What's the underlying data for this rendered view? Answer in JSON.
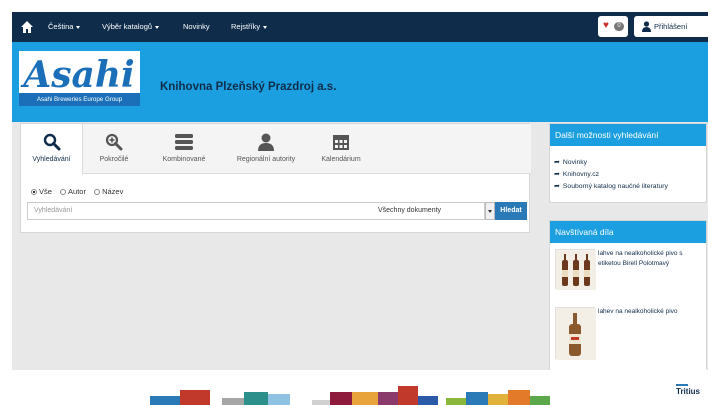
{
  "navbar": {
    "items": [
      {
        "label": "Čeština",
        "dropdown": true
      },
      {
        "label": "Výběr katalogů",
        "dropdown": true
      },
      {
        "label": "Novinky",
        "dropdown": false
      },
      {
        "label": "Rejstříky",
        "dropdown": true
      }
    ],
    "favorites_count": "0",
    "login_label": "Přihlášení"
  },
  "header": {
    "logo_wordmark": "Asahi",
    "logo_subtitle": "Asahi Breweries Europe Group",
    "library_name": "Knihovna Plzeňský Prazdroj a.s."
  },
  "search": {
    "tabs": [
      {
        "label": "Vyhledávání",
        "icon": "search-icon"
      },
      {
        "label": "Pokročilé",
        "icon": "zoom-in-icon"
      },
      {
        "label": "Kombinované",
        "icon": "stack-icon"
      },
      {
        "label": "Regionální autority",
        "icon": "user-icon"
      },
      {
        "label": "Kalendárium",
        "icon": "calendar-icon"
      }
    ],
    "scope_options": [
      "Vše",
      "Autor",
      "Název"
    ],
    "selected_scope": "Vše",
    "placeholder": "Vyhledávání",
    "document_filter": "Všechny dokumenty",
    "button_label": "Hledat"
  },
  "sidebar": {
    "more_options": {
      "title": "Další možnosti vyhledávání",
      "links": [
        "Novinky",
        "Knihovny.cz",
        "Souborný katalog naučné literatury"
      ]
    },
    "visited": {
      "title": "Navštívaná díla",
      "items": [
        {
          "title": "lahve na nealkoholické pivo s etiketou Birell Polotmavý"
        },
        {
          "title": "lahev na nealkoholické pivo"
        }
      ]
    }
  },
  "footer": {
    "brand": "Tritius"
  },
  "colors": {
    "navbar": "#0f2d4a",
    "header": "#1b9fe0",
    "button": "#2a7ab8",
    "logo_red": "#d71920",
    "logo_subtitle_bg": "#1b6fb8"
  }
}
